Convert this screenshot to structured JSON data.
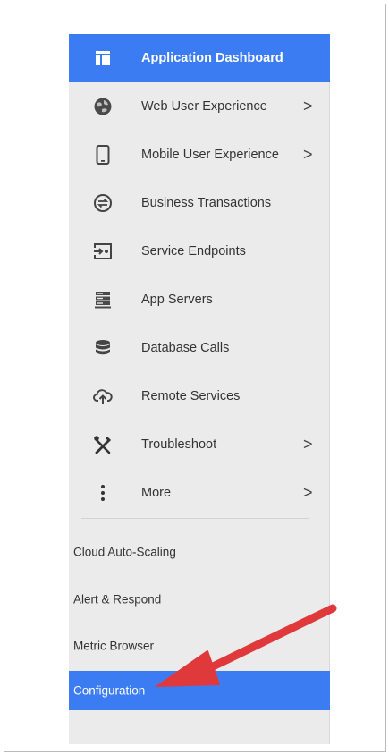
{
  "menu": {
    "items": [
      {
        "label": "Application Dashboard",
        "icon": "dashboard-icon",
        "has_submenu": false,
        "active": true
      },
      {
        "label": "Web User Experience",
        "icon": "globe-icon",
        "has_submenu": true,
        "active": false
      },
      {
        "label": "Mobile User Experience",
        "icon": "mobile-icon",
        "has_submenu": true,
        "active": false
      },
      {
        "label": "Business Transactions",
        "icon": "transactions-icon",
        "has_submenu": false,
        "active": false
      },
      {
        "label": "Service Endpoints",
        "icon": "endpoint-icon",
        "has_submenu": false,
        "active": false
      },
      {
        "label": "App Servers",
        "icon": "server-icon",
        "has_submenu": false,
        "active": false
      },
      {
        "label": "Database Calls",
        "icon": "database-icon",
        "has_submenu": false,
        "active": false
      },
      {
        "label": "Remote Services",
        "icon": "cloud-upload-icon",
        "has_submenu": false,
        "active": false
      },
      {
        "label": "Troubleshoot",
        "icon": "tools-icon",
        "has_submenu": true,
        "active": false
      },
      {
        "label": "More",
        "icon": "more-vertical-icon",
        "has_submenu": true,
        "active": false
      }
    ],
    "chevron": ">",
    "secondary": [
      {
        "label": "Cloud Auto-Scaling",
        "active": false
      },
      {
        "label": "Alert & Respond",
        "active": false
      },
      {
        "label": "Metric Browser",
        "active": false
      },
      {
        "label": "Configuration",
        "active": true
      }
    ]
  },
  "colors": {
    "accent": "#3b7cf2",
    "menu_bg": "#ebebeb",
    "text": "#333333",
    "arrow": "#e0393c"
  }
}
